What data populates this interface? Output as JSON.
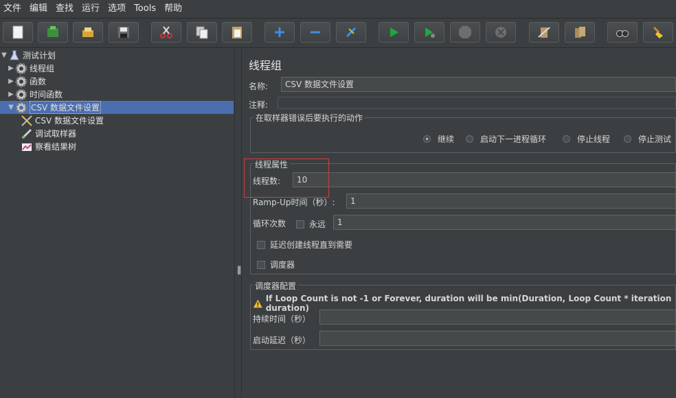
{
  "menu": [
    "文件",
    "编辑",
    "查找",
    "运行",
    "选项",
    "Tools",
    "帮助"
  ],
  "toolbar": {
    "buttons": [
      "new-icon",
      "templates-icon",
      "open-icon",
      "save-icon",
      "cut-icon",
      "copy-icon",
      "paste-icon",
      "expand-icon",
      "collapse-icon",
      "toggle-icon",
      "start-icon",
      "start-no-pause-icon",
      "stop-icon",
      "shutdown-icon",
      "clear-icon",
      "clear-all-icon",
      "search-icon",
      "reset-search-icon"
    ]
  },
  "tree": {
    "items": [
      {
        "label": "测试计划",
        "icon": "test-plan-icon"
      },
      {
        "label": "线程组",
        "icon": "gear-icon"
      },
      {
        "label": "函数",
        "icon": "gear-icon"
      },
      {
        "label": "时间函数",
        "icon": "gear-icon"
      },
      {
        "label": "CSV 数据文件设置",
        "icon": "gear-icon"
      },
      {
        "label": "CSV 数据文件设置",
        "icon": "scissors-icon"
      },
      {
        "label": "调试取样器",
        "icon": "sampler-icon"
      },
      {
        "label": "察看结果树",
        "icon": "chart-icon"
      }
    ]
  },
  "panel": {
    "title": "线程组",
    "name_label": "名称:",
    "name_value": "CSV 数据文件设置",
    "comment_label": "注释:",
    "comment_value": "",
    "error_action": {
      "legend": "在取样器错误后要执行的动作",
      "options": [
        "继续",
        "启动下一进程循环",
        "停止线程",
        "停止测试"
      ],
      "selected": "继续"
    },
    "thread_props": {
      "legend": "线程属性",
      "threads_label": "线程数:",
      "threads_value": "10",
      "rampup_label": "Ramp-Up时间（秒）:",
      "rampup_value": "1",
      "loop_label": "循环次数",
      "forever_label": "永远",
      "loop_value": "1",
      "delay_label": "延迟创建线程直到需要",
      "scheduler_label": "调度器"
    },
    "scheduler": {
      "legend": "调度器配置",
      "warning": "If Loop Count is not -1 or Forever, duration will be min(Duration, Loop Count * iteration duration)",
      "duration_label": "持续时间（秒）",
      "duration_value": "",
      "startup_label": "启动延迟（秒）",
      "startup_value": ""
    }
  },
  "colors": {
    "accent_selected": "#4b6eaf",
    "highlight_box": "#d23c3c",
    "play_green": "#1fa83a"
  }
}
